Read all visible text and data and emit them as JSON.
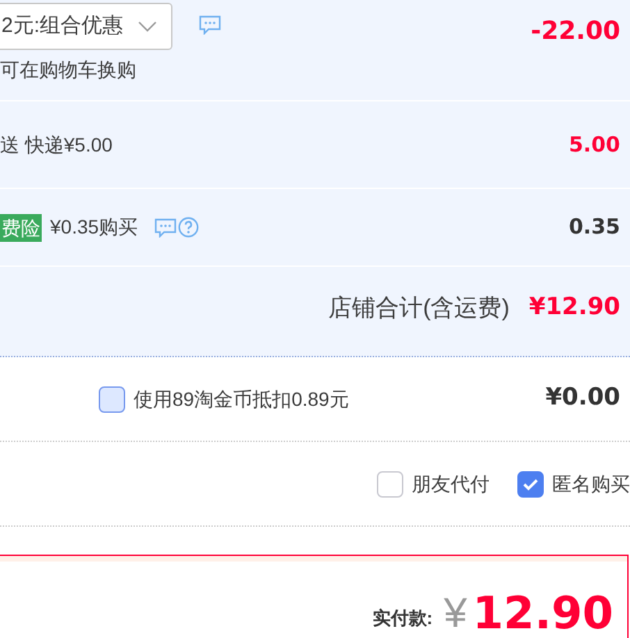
{
  "promo": {
    "dropdown_value": "2元:组合优惠",
    "note": "可在购物车换购",
    "amount": "-22.00"
  },
  "shipping": {
    "label": "送 快递¥5.00",
    "amount": "5.00"
  },
  "insurance": {
    "badge": "费险",
    "label": "¥0.35购买",
    "amount": "0.35"
  },
  "shop_total": {
    "label": "店铺合计(含运费)",
    "amount": "¥12.90"
  },
  "coins": {
    "label": "使用89淘金币抵扣0.89元",
    "checked": false,
    "amount": "¥0.00"
  },
  "options": [
    {
      "label": "朋友代付",
      "checked": false
    },
    {
      "label": "匿名购买",
      "checked": true
    }
  ],
  "payment": {
    "label": "实付款:",
    "currency": "¥",
    "amount": "12.90"
  }
}
